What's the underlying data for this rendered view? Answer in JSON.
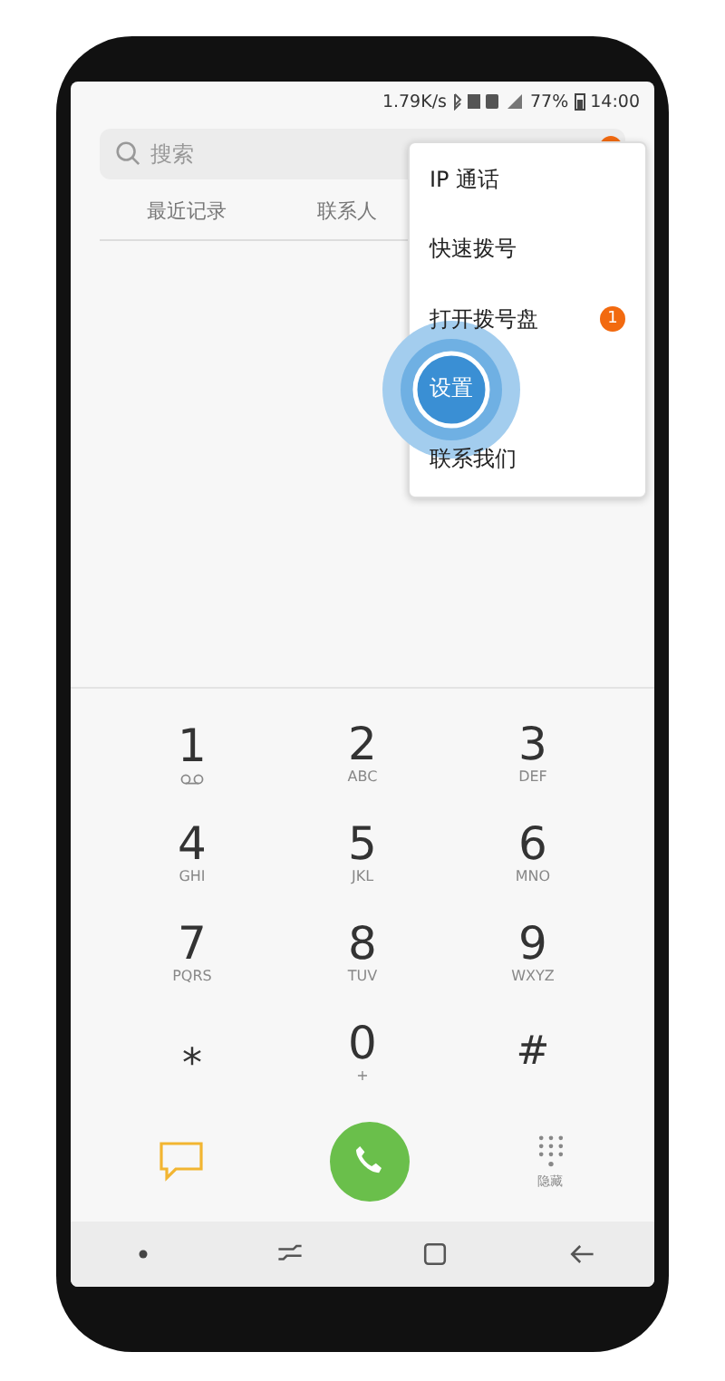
{
  "status_bar": {
    "speed": "1.79K/s",
    "battery": "77%",
    "time": "14:00"
  },
  "search": {
    "placeholder": "搜索"
  },
  "tabs": [
    {
      "label": "最近记录"
    },
    {
      "label": "联系人"
    }
  ],
  "menu": [
    {
      "label": "IP 通话",
      "pressed": false
    },
    {
      "label": "快速拨号",
      "pressed": false
    },
    {
      "label": "打开拨号盘",
      "pressed": false,
      "badge": "1"
    },
    {
      "label": "设置",
      "pressed": true
    },
    {
      "label": "联系我们",
      "pressed": false
    }
  ],
  "keypad": [
    {
      "digit": "1",
      "kind": "voicemail"
    },
    {
      "digit": "2",
      "letters": "ABC",
      "kind": "letters"
    },
    {
      "digit": "3",
      "letters": "DEF",
      "kind": "letters"
    },
    {
      "digit": "4",
      "letters": "GHI",
      "kind": "letters"
    },
    {
      "digit": "5",
      "letters": "JKL",
      "kind": "letters"
    },
    {
      "digit": "6",
      "letters": "MNO",
      "kind": "letters"
    },
    {
      "digit": "7",
      "letters": "PQRS",
      "kind": "letters"
    },
    {
      "digit": "8",
      "letters": "TUV",
      "kind": "letters"
    },
    {
      "digit": "9",
      "letters": "WXYZ",
      "kind": "letters"
    },
    {
      "digit": "⁎",
      "kind": "plain"
    },
    {
      "digit": "0",
      "letters": "+",
      "kind": "letters"
    },
    {
      "digit": "#",
      "kind": "plain"
    }
  ],
  "hide_label": "隐藏"
}
